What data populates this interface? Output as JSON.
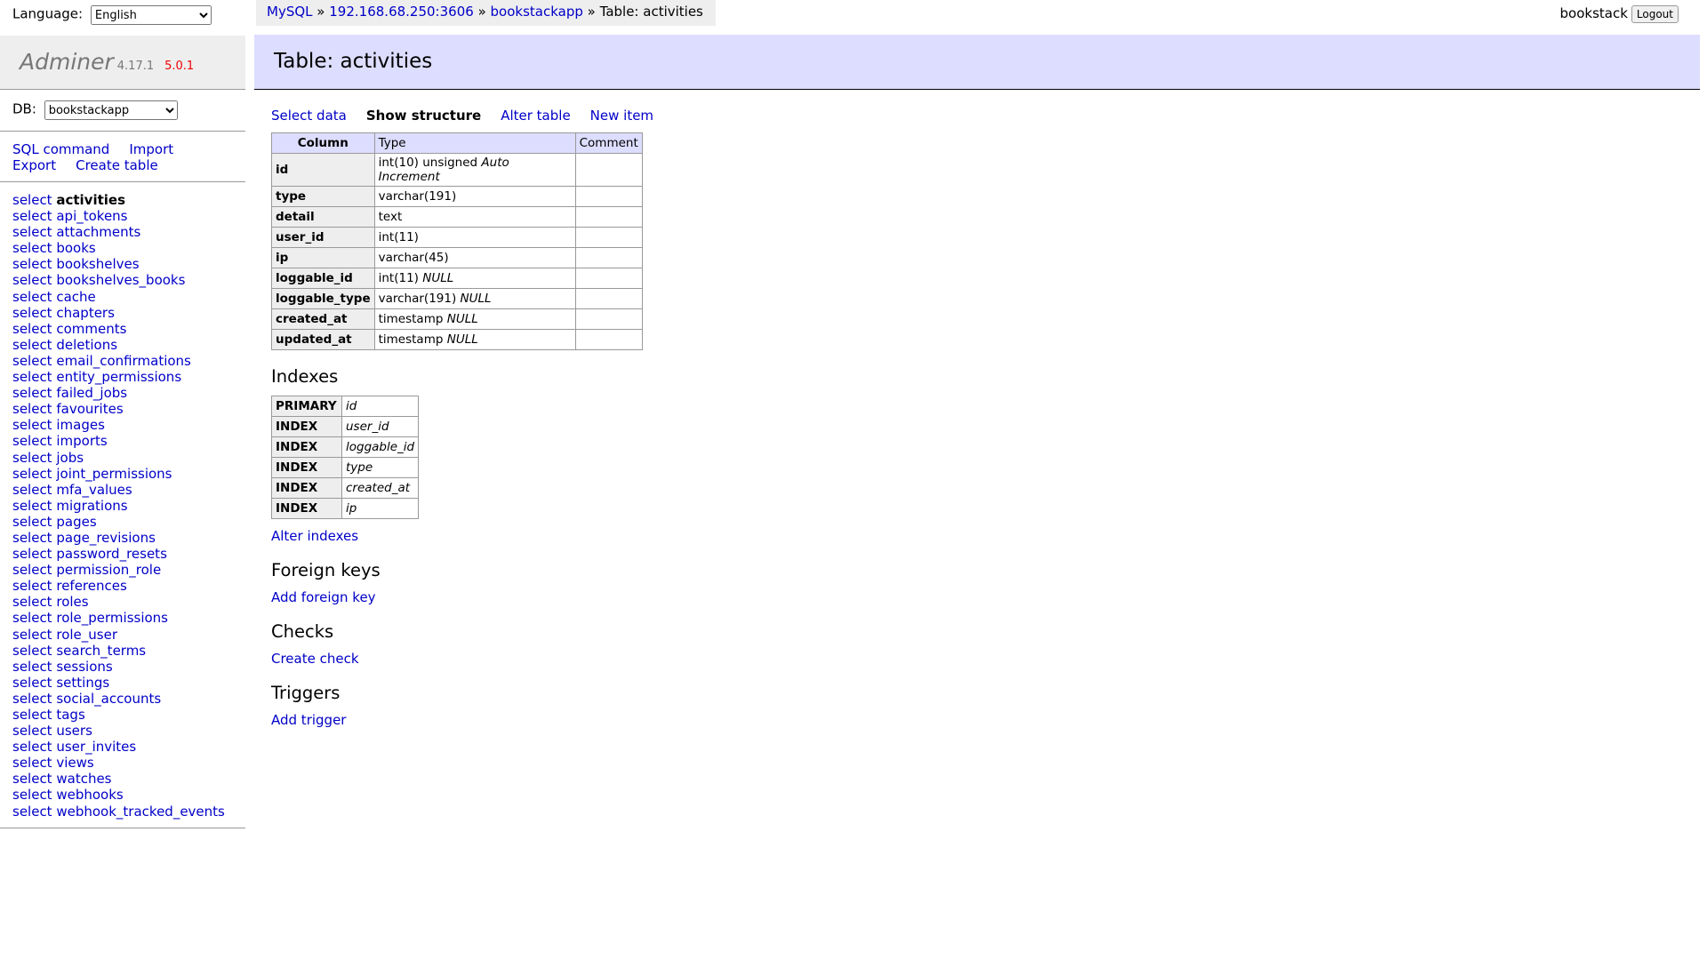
{
  "language": {
    "label": "Language:",
    "selected": "English"
  },
  "logo": {
    "name": "Adminer",
    "version": "4.17.1",
    "new_version": "5.0.1"
  },
  "db": {
    "label": "DB:",
    "selected": "bookstackapp"
  },
  "side_links": {
    "sql_command": "SQL command",
    "import": "Import",
    "export": "Export",
    "create_table": "Create table"
  },
  "tables": [
    {
      "prefix": "select",
      "name": "activities"
    },
    {
      "prefix": "select",
      "name": "api_tokens"
    },
    {
      "prefix": "select",
      "name": "attachments"
    },
    {
      "prefix": "select",
      "name": "books"
    },
    {
      "prefix": "select",
      "name": "bookshelves"
    },
    {
      "prefix": "select",
      "name": "bookshelves_books"
    },
    {
      "prefix": "select",
      "name": "cache"
    },
    {
      "prefix": "select",
      "name": "chapters"
    },
    {
      "prefix": "select",
      "name": "comments"
    },
    {
      "prefix": "select",
      "name": "deletions"
    },
    {
      "prefix": "select",
      "name": "email_confirmations"
    },
    {
      "prefix": "select",
      "name": "entity_permissions"
    },
    {
      "prefix": "select",
      "name": "failed_jobs"
    },
    {
      "prefix": "select",
      "name": "favourites"
    },
    {
      "prefix": "select",
      "name": "images"
    },
    {
      "prefix": "select",
      "name": "imports"
    },
    {
      "prefix": "select",
      "name": "jobs"
    },
    {
      "prefix": "select",
      "name": "joint_permissions"
    },
    {
      "prefix": "select",
      "name": "mfa_values"
    },
    {
      "prefix": "select",
      "name": "migrations"
    },
    {
      "prefix": "select",
      "name": "pages"
    },
    {
      "prefix": "select",
      "name": "page_revisions"
    },
    {
      "prefix": "select",
      "name": "password_resets"
    },
    {
      "prefix": "select",
      "name": "permission_role"
    },
    {
      "prefix": "select",
      "name": "references"
    },
    {
      "prefix": "select",
      "name": "roles"
    },
    {
      "prefix": "select",
      "name": "role_permissions"
    },
    {
      "prefix": "select",
      "name": "role_user"
    },
    {
      "prefix": "select",
      "name": "search_terms"
    },
    {
      "prefix": "select",
      "name": "sessions"
    },
    {
      "prefix": "select",
      "name": "settings"
    },
    {
      "prefix": "select",
      "name": "social_accounts"
    },
    {
      "prefix": "select",
      "name": "tags"
    },
    {
      "prefix": "select",
      "name": "users"
    },
    {
      "prefix": "select",
      "name": "user_invites"
    },
    {
      "prefix": "select",
      "name": "views"
    },
    {
      "prefix": "select",
      "name": "watches"
    },
    {
      "prefix": "select",
      "name": "webhooks"
    },
    {
      "prefix": "select",
      "name": "webhook_tracked_events"
    }
  ],
  "breadcrumb": {
    "mysql": "MySQL",
    "server": "192.168.68.250:3606",
    "database": "bookstackapp",
    "current": "Table: activities",
    "sep": "»"
  },
  "user": {
    "name": "bookstack",
    "logout": "Logout"
  },
  "page_title": "Table: activities",
  "actions": {
    "select_data": "Select data",
    "show_structure": "Show structure",
    "alter_table": "Alter table",
    "new_item": "New item"
  },
  "structure": {
    "headers": [
      "Column",
      "Type",
      "Comment"
    ],
    "rows": [
      {
        "column": "id",
        "type": "int(10) unsigned",
        "extra": "Auto Increment",
        "comment": ""
      },
      {
        "column": "type",
        "type": "varchar(191)",
        "extra": "",
        "comment": ""
      },
      {
        "column": "detail",
        "type": "text",
        "extra": "",
        "comment": ""
      },
      {
        "column": "user_id",
        "type": "int(11)",
        "extra": "",
        "comment": ""
      },
      {
        "column": "ip",
        "type": "varchar(45)",
        "extra": "",
        "comment": ""
      },
      {
        "column": "loggable_id",
        "type": "int(11)",
        "extra": "NULL",
        "comment": ""
      },
      {
        "column": "loggable_type",
        "type": "varchar(191)",
        "extra": "NULL",
        "comment": ""
      },
      {
        "column": "created_at",
        "type": "timestamp",
        "extra": "NULL",
        "comment": ""
      },
      {
        "column": "updated_at",
        "type": "timestamp",
        "extra": "NULL",
        "comment": ""
      }
    ]
  },
  "indexes": {
    "title": "Indexes",
    "rows": [
      {
        "kind": "PRIMARY",
        "column": "id"
      },
      {
        "kind": "INDEX",
        "column": "user_id"
      },
      {
        "kind": "INDEX",
        "column": "loggable_id"
      },
      {
        "kind": "INDEX",
        "column": "type"
      },
      {
        "kind": "INDEX",
        "column": "created_at"
      },
      {
        "kind": "INDEX",
        "column": "ip"
      }
    ],
    "alter_link": "Alter indexes"
  },
  "foreign_keys": {
    "title": "Foreign keys",
    "link": "Add foreign key"
  },
  "checks": {
    "title": "Checks",
    "link": "Create check"
  },
  "triggers": {
    "title": "Triggers",
    "link": "Add trigger"
  }
}
